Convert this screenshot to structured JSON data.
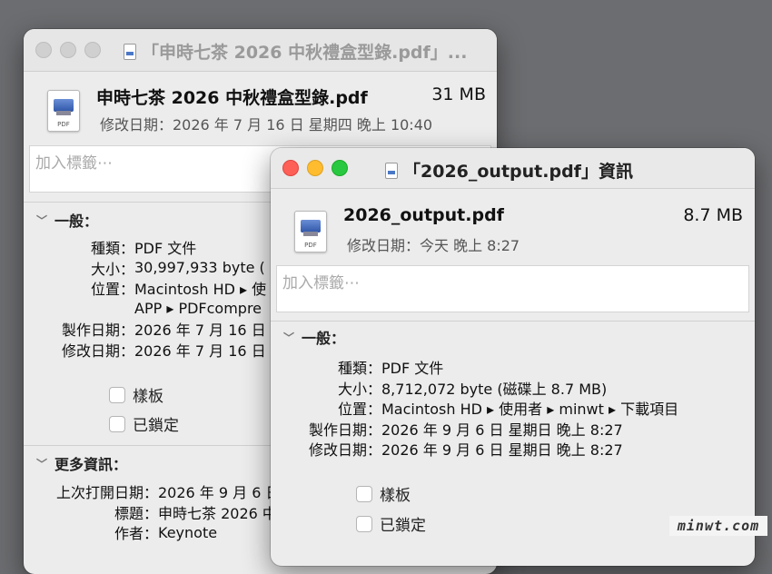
{
  "back_window": {
    "title": "「申時七茶 2026 中秋禮盒型錄.pdf」...",
    "file_name": "申時七茶 2026 中秋禮盒型錄.pdf",
    "file_size": "31 MB",
    "modified": "修改日期：2026 年 7 月 16 日 星期四 晚上 10:40",
    "tag_placeholder": "加入標籤⋯",
    "icon_label": "PDF",
    "general_title": "一般：",
    "info": [
      {
        "k": "種類：",
        "v": "PDF 文件"
      },
      {
        "k": "大小：",
        "v": "30,997,933 byte ("
      },
      {
        "k": "位置：",
        "v": "Macintosh HD ▸ 使"
      },
      {
        "k": "",
        "v": "APP ▸ PDFcompre"
      },
      {
        "k": "製作日期：",
        "v": "2026 年 7 月 16 日 星"
      },
      {
        "k": "修改日期：",
        "v": "2026 年 7 月 16 日 星"
      }
    ],
    "stationery_label": "樣板",
    "locked_label": "已鎖定",
    "more_info_title": "更多資訊：",
    "more_info": [
      {
        "k": "上次打開日期：",
        "v": "2026 年 9 月 6 日"
      },
      {
        "k": "標題：",
        "v": "申時七茶 2026 中"
      },
      {
        "k": "作者：",
        "v": "Keynote"
      }
    ]
  },
  "front_window": {
    "title": "「2026_output.pdf」資訊",
    "file_name": "2026_output.pdf",
    "file_size": "8.7 MB",
    "modified": "修改日期：今天 晚上 8:27",
    "tag_placeholder": "加入標籤⋯",
    "icon_label": "PDF",
    "general_title": "一般：",
    "info": [
      {
        "k": "種類：",
        "v": "PDF 文件"
      },
      {
        "k": "大小：",
        "v": "8,712,072 byte (磁碟上 8.7 MB)"
      },
      {
        "k": "位置：",
        "v": "Macintosh HD ▸ 使用者 ▸ minwt ▸ 下載項目"
      },
      {
        "k": "製作日期：",
        "v": "2026 年 9 月 6 日 星期日 晚上 8:27"
      },
      {
        "k": "修改日期：",
        "v": "2026 年 9 月 6 日 星期日 晚上 8:27"
      }
    ],
    "stationery_label": "樣板",
    "locked_label": "已鎖定"
  },
  "watermark": "minwt.com"
}
